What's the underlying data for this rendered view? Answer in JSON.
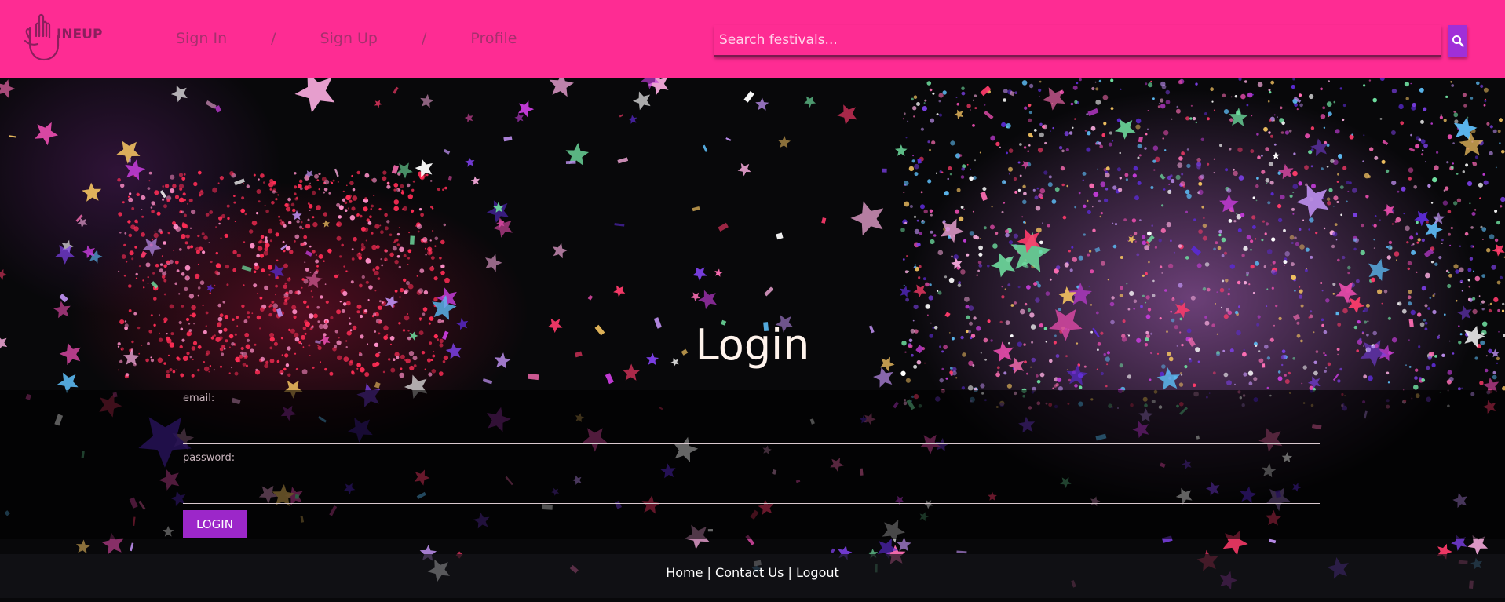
{
  "header": {
    "logo_text": "INEUP",
    "nav": {
      "signin_label": "Sign In",
      "separator": "/",
      "signup_label": "Sign Up",
      "profile_label": "Profile"
    },
    "search": {
      "placeholder": "Search festivals...",
      "value": "",
      "icon": "search-icon"
    },
    "colors": {
      "background": "#fe2c93",
      "nav_text": "#a5306d",
      "search_button": "#a02fd8"
    }
  },
  "main": {
    "title": "Login",
    "form": {
      "email_label": "email:",
      "email_value": "",
      "password_label": "password:",
      "password_value": "",
      "submit_label": "LOGIN",
      "submit_color": "#9c27c9"
    }
  },
  "footer": {
    "home_label": "Home",
    "contact_label": "Contact Us",
    "logout_label": "Logout",
    "separator": "|"
  },
  "background": {
    "description_icon": "confetti-background"
  }
}
